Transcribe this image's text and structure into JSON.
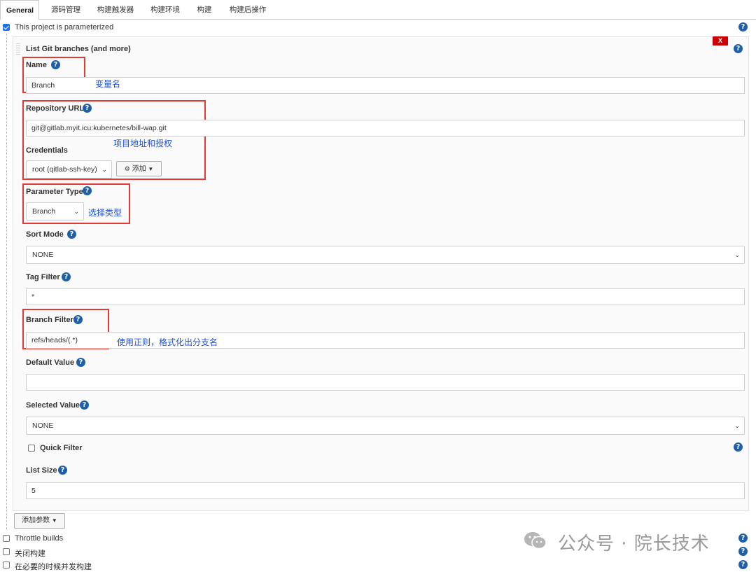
{
  "tabs": [
    {
      "label": "General",
      "active": true
    },
    {
      "label": "源码管理"
    },
    {
      "label": "构建触发器"
    },
    {
      "label": "构建环境"
    },
    {
      "label": "构建"
    },
    {
      "label": "构建后操作"
    }
  ],
  "parameterized": {
    "label": "This project is parameterized",
    "checked": true
  },
  "param_block": {
    "title": "List Git branches (and more)",
    "delete_label": "X",
    "name": {
      "label": "Name",
      "value": "Branch",
      "annotation": "变量名"
    },
    "repository_url": {
      "label": "Repository URL",
      "value": "git@gitlab.myit.icu:kubernetes/bill-wap.git"
    },
    "credentials": {
      "label": "Credentials",
      "selected": "root (qitlab-ssh-key)",
      "add_label": "添加",
      "annotation": "项目地址和授权"
    },
    "parameter_type": {
      "label": "Parameter Type",
      "selected": "Branch",
      "annotation": "选择类型"
    },
    "sort_mode": {
      "label": "Sort Mode",
      "selected": "NONE"
    },
    "tag_filter": {
      "label": "Tag Filter",
      "value": "*"
    },
    "branch_filter": {
      "label": "Branch Filter",
      "value": "refs/heads/(.*)",
      "annotation": "使用正则，格式化出分支名"
    },
    "default_value": {
      "label": "Default Value",
      "value": ""
    },
    "selected_value": {
      "label": "Selected Value",
      "selected": "NONE"
    },
    "quick_filter": {
      "label": "Quick Filter",
      "checked": false
    },
    "list_size": {
      "label": "List Size",
      "value": "5"
    }
  },
  "add_param_button": "添加参数",
  "bottom_options": [
    {
      "label": "Throttle builds",
      "checked": false
    },
    {
      "label": "关闭构建",
      "checked": false
    },
    {
      "label": "在必要的时候并发构建",
      "checked": false
    }
  ],
  "watermark": "公众号 · 院长技术",
  "icons": {
    "help": "help-icon",
    "checkbox": "checkbox",
    "caret": "chevron-down-icon",
    "key": "key-icon"
  },
  "colors": {
    "help": "#1f5fa8",
    "annotation_box": "#e53935",
    "annotation_text": "#1e50d8",
    "delete": "#cc0000",
    "checkbox_checked": "#1a73e8"
  }
}
